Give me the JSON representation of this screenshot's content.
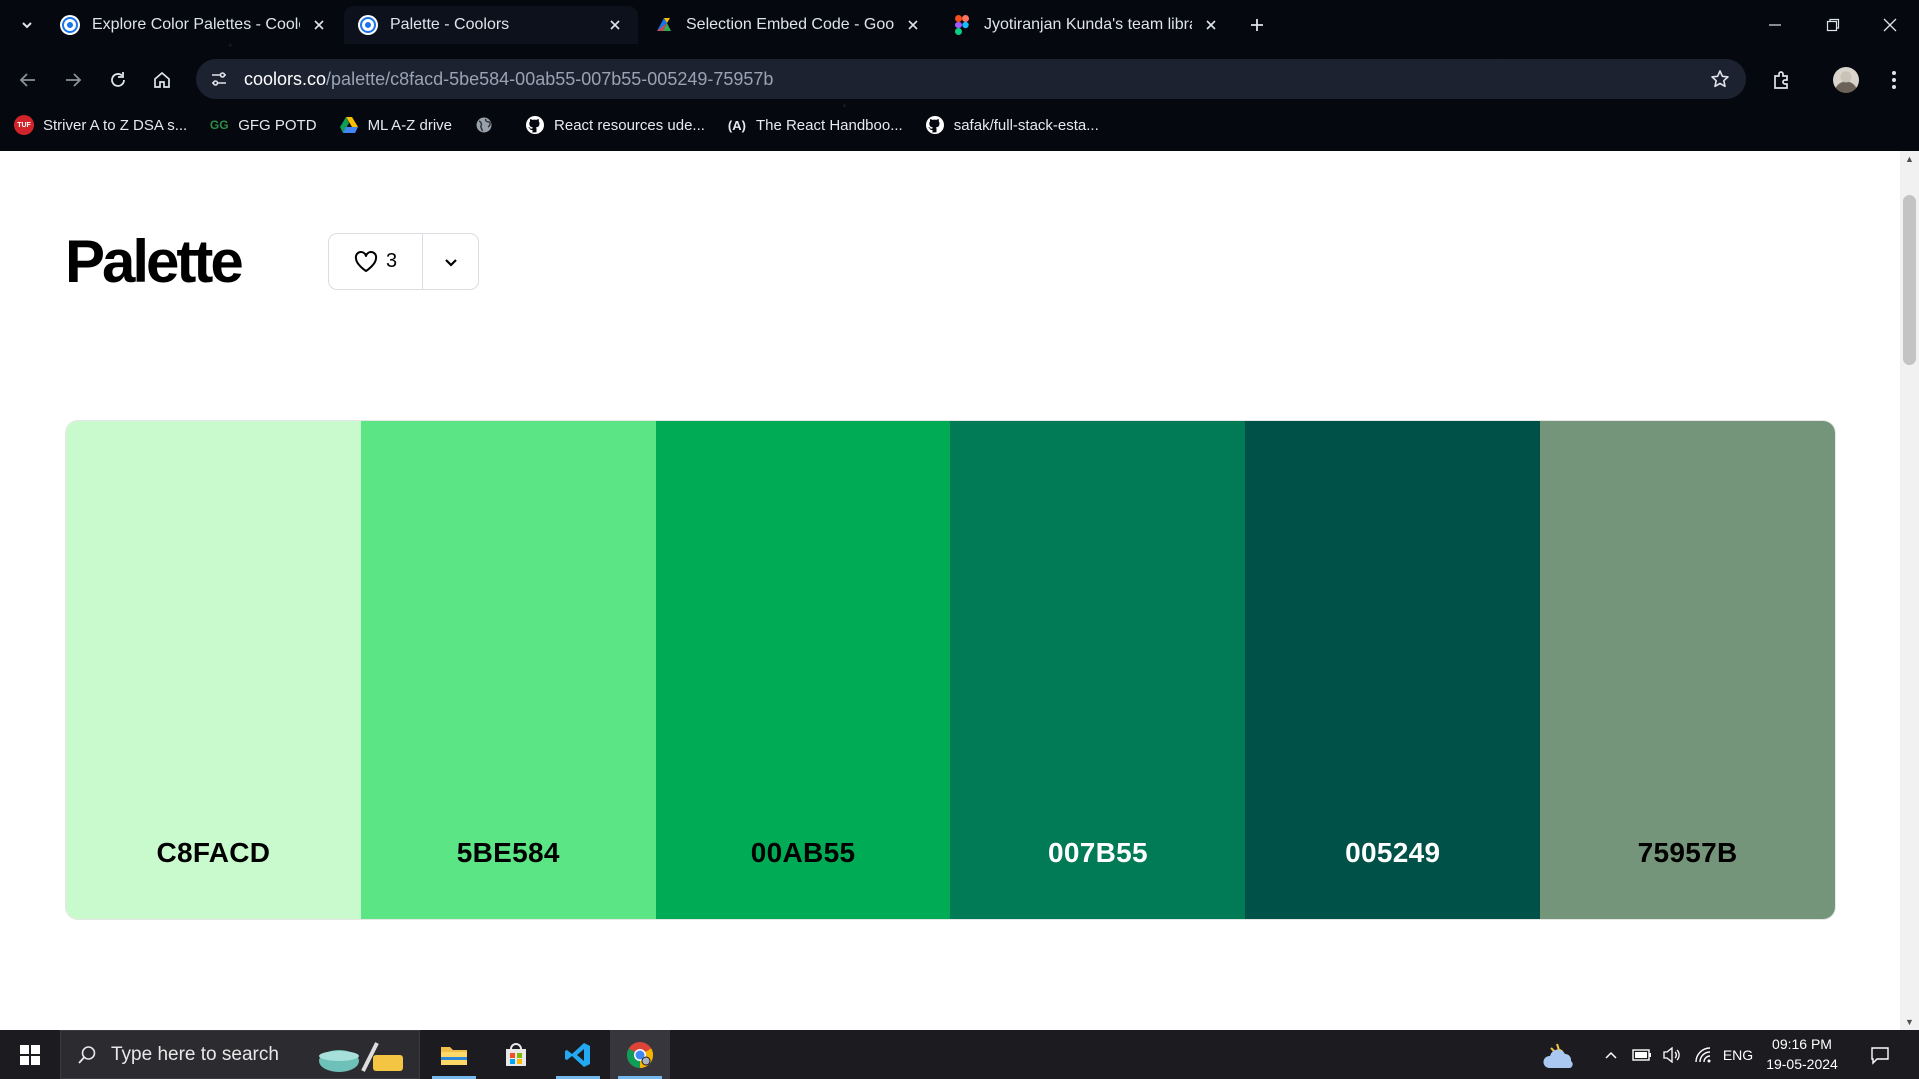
{
  "browser": {
    "tabs": [
      {
        "title": "Explore Color Palettes - Coolors",
        "active": false,
        "favicon": "coolors-icon"
      },
      {
        "title": "Palette - Coolors",
        "active": true,
        "favicon": "coolors-icon"
      },
      {
        "title": "Selection Embed Code - Google",
        "active": false,
        "favicon": "google-sites-icon"
      },
      {
        "title": "Jyotiranjan Kunda's team library",
        "active": false,
        "favicon": "figma-icon"
      }
    ],
    "url_host": "coolors.co",
    "url_path": "/palette/c8facd-5be584-00ab55-007b55-005249-75957b",
    "bookmarks": [
      {
        "label": "Striver A to Z DSA s...",
        "icon": "tuf-icon"
      },
      {
        "label": "GFG POTD",
        "icon": "gfg-icon"
      },
      {
        "label": "ML A-Z drive",
        "icon": "google-drive-icon"
      },
      {
        "label": "",
        "icon": "globe-icon"
      },
      {
        "label": "React resources ude...",
        "icon": "github-icon"
      },
      {
        "label": "The React Handboo...",
        "icon": "react-handbook-icon"
      },
      {
        "label": "safak/full-stack-esta...",
        "icon": "github-icon"
      }
    ]
  },
  "page": {
    "title": "Palette",
    "likes": "3",
    "swatches": [
      {
        "hex": "C8FACD",
        "color": "#C8FACD",
        "text_color": "#000000"
      },
      {
        "hex": "5BE584",
        "color": "#5BE584",
        "text_color": "#000000"
      },
      {
        "hex": "00AB55",
        "color": "#00AB55",
        "text_color": "#000000"
      },
      {
        "hex": "007B55",
        "color": "#007B55",
        "text_color": "#FFFFFF"
      },
      {
        "hex": "005249",
        "color": "#005249",
        "text_color": "#FFFFFF"
      },
      {
        "hex": "75957B",
        "color": "#75957B",
        "text_color": "#000000"
      }
    ]
  },
  "taskbar": {
    "search_placeholder": "Type here to search",
    "language": "ENG",
    "time": "09:16 PM",
    "date": "19-05-2024"
  }
}
